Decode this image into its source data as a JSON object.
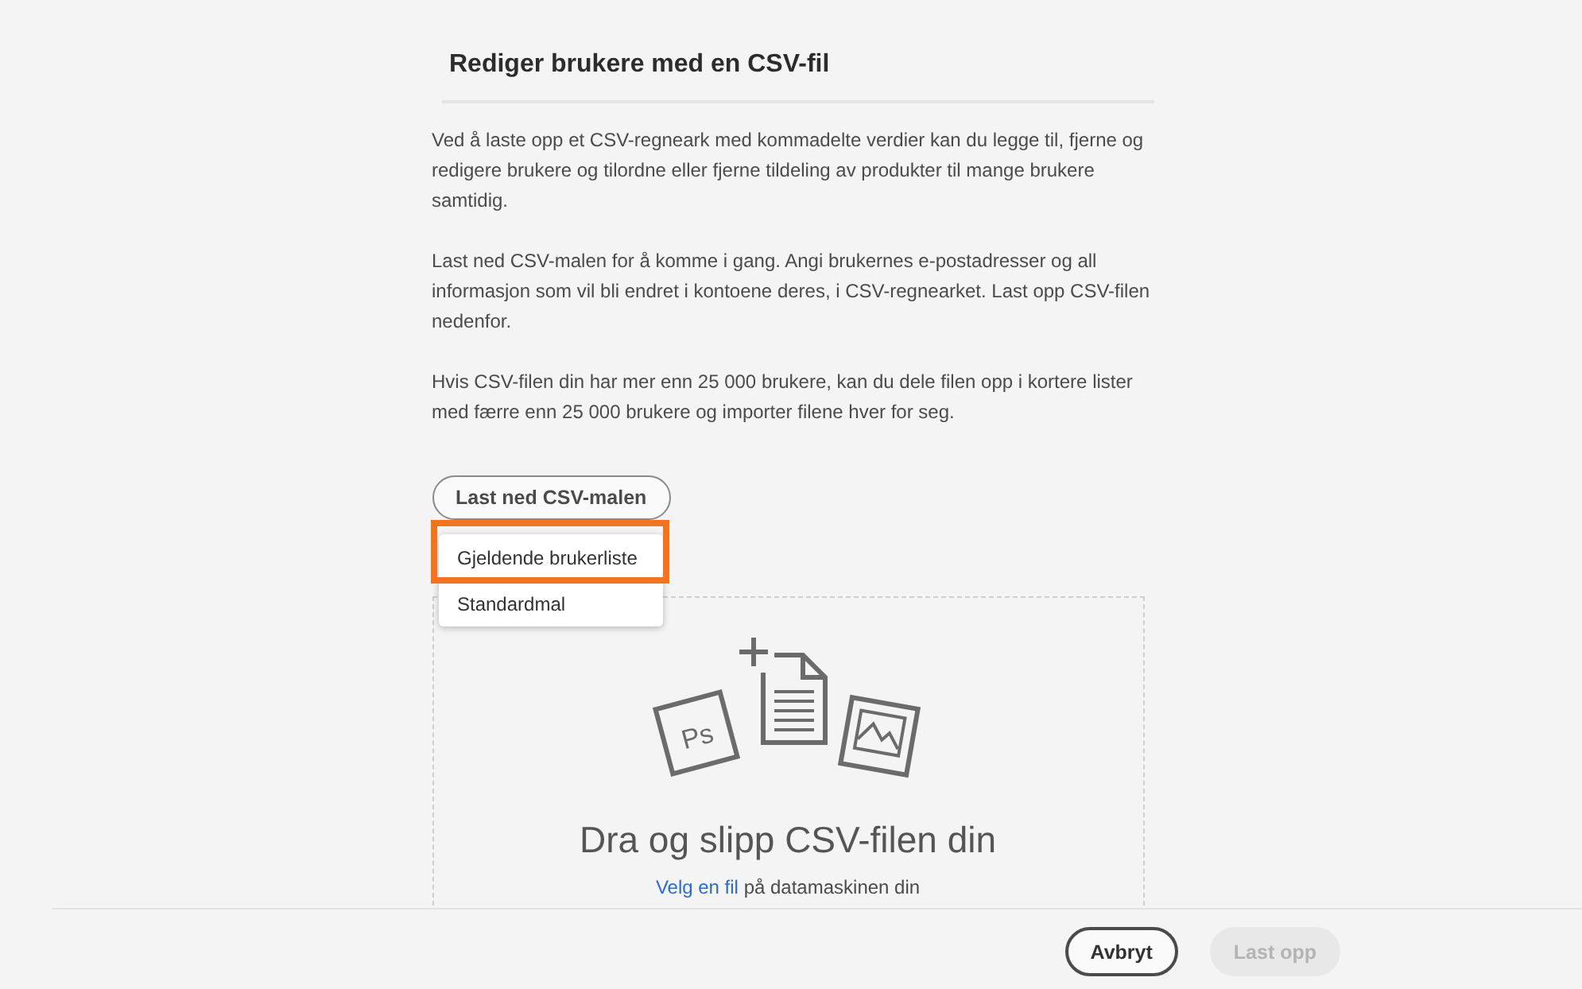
{
  "dialog": {
    "title": "Rediger brukere med en CSV-fil"
  },
  "paragraphs": [
    "Ved å laste opp et CSV-regneark med kommadelte verdier kan du legge til, fjerne og redigere brukere og tilordne eller fjerne tildeling av produkter til mange brukere samtidig.",
    "Last ned CSV-malen for å komme i gang. Angi brukernes e-postadresser og all informasjon som vil bli endret i kontoene deres, i CSV-regnearket. Last opp CSV-filen nedenfor.",
    "Hvis CSV-filen din har mer enn 25 000 brukere, kan du dele filen opp i kortere lister med færre enn 25 000 brukere og importer filene hver for seg."
  ],
  "template_button": {
    "label": "Last ned CSV-malen"
  },
  "template_menu": [
    {
      "label": "Gjeldende brukerliste",
      "highlighted": true
    },
    {
      "label": "Standardmal",
      "highlighted": false
    }
  ],
  "drop_zone": {
    "icon_label": "Ps",
    "heading": "Dra og slipp CSV-filen din",
    "link": "Velg en fil",
    "hint": "på datamaskinen din"
  },
  "footer": {
    "buttons": [
      {
        "label": "Avbryt",
        "disabled": false
      },
      {
        "label": "Last opp",
        "disabled": true
      }
    ]
  }
}
